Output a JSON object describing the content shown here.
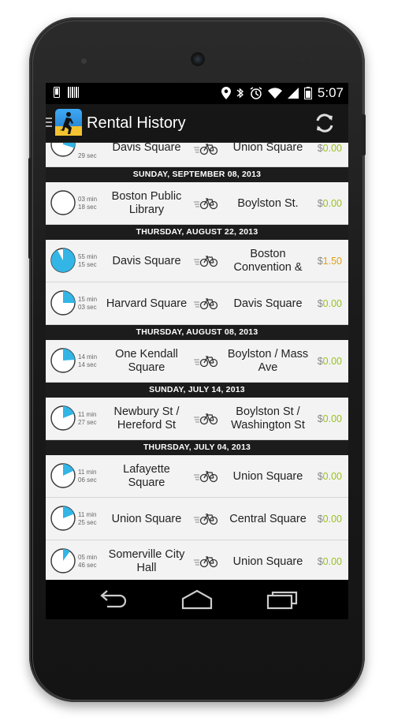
{
  "status_bar": {
    "time": "5:07",
    "icons": [
      "phone-icon",
      "barcode-icon",
      "location-icon",
      "bluetooth-icon",
      "alarm-icon",
      "wifi-icon",
      "signal-icon",
      "battery-icon"
    ]
  },
  "action_bar": {
    "title": "Rental History",
    "refresh_icon": "refresh-icon"
  },
  "colors": {
    "accent": "#33b5e5",
    "price_free": "#98c21f",
    "price_paid": "#e0a016",
    "section_bg": "#1c1c1c"
  },
  "list": {
    "top_partial": {
      "minutes": "",
      "seconds": "29 sec",
      "fraction": 0.3,
      "from": "Davis Square",
      "to": "Union Square",
      "currency": "$",
      "amount": "0.00"
    },
    "sections": [
      {
        "date": "SUNDAY, SEPTEMBER 08, 2013",
        "rentals": [
          {
            "minutes": "03 min",
            "seconds": "18 sec",
            "fraction": 0.0,
            "from": "Boston Public Library",
            "to": "Boylston St.",
            "currency": "$",
            "amount": "0.00",
            "paid": false
          }
        ]
      },
      {
        "date": "THURSDAY, AUGUST 22, 2013",
        "rentals": [
          {
            "minutes": "55 min",
            "seconds": "15 sec",
            "fraction": 0.92,
            "from": "Davis Square",
            "to": "Boston Convention &",
            "currency": "$",
            "amount": "1.50",
            "paid": true
          },
          {
            "minutes": "15 min",
            "seconds": "03 sec",
            "fraction": 0.25,
            "from": "Harvard Square",
            "to": "Davis Square",
            "currency": "$",
            "amount": "0.00",
            "paid": false
          }
        ]
      },
      {
        "date": "THURSDAY, AUGUST 08, 2013",
        "rentals": [
          {
            "minutes": "14 min",
            "seconds": "14 sec",
            "fraction": 0.24,
            "from": "One Kendall Square",
            "to": "Boylston / Mass Ave",
            "currency": "$",
            "amount": "0.00",
            "paid": false
          }
        ]
      },
      {
        "date": "SUNDAY, JULY 14, 2013",
        "rentals": [
          {
            "minutes": "11 min",
            "seconds": "27 sec",
            "fraction": 0.19,
            "from": "Newbury St / Hereford St",
            "to": "Boylston St / Washington St",
            "currency": "$",
            "amount": "0.00",
            "paid": false
          }
        ]
      },
      {
        "date": "THURSDAY, JULY 04, 2013",
        "rentals": [
          {
            "minutes": "11 min",
            "seconds": "06 sec",
            "fraction": 0.18,
            "from": "Lafayette Square",
            "to": "Union Square",
            "currency": "$",
            "amount": "0.00",
            "paid": false
          },
          {
            "minutes": "11 min",
            "seconds": "25 sec",
            "fraction": 0.19,
            "from": "Union Square",
            "to": "Central Square",
            "currency": "$",
            "amount": "0.00",
            "paid": false
          },
          {
            "minutes": "05 min",
            "seconds": "46 sec",
            "fraction": 0.1,
            "from": "Somerville City Hall",
            "to": "Union Square",
            "currency": "$",
            "amount": "0.00",
            "paid": false
          }
        ]
      }
    ]
  },
  "nav_bar": {
    "buttons": [
      "back-icon",
      "home-icon",
      "recent-apps-icon"
    ]
  }
}
